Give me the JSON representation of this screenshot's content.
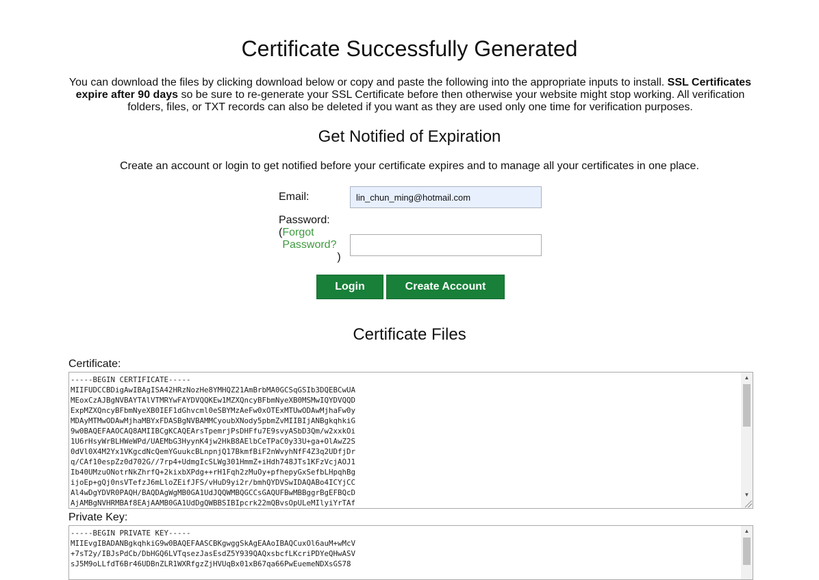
{
  "header": {
    "title": "Certificate Successfully Generated",
    "intro_before": "You can download the files by clicking download below or copy and paste the following into the appropriate inputs to install. ",
    "intro_bold": "SSL Certificates expire after 90 days",
    "intro_after": " so be sure to re-generate your SSL Certificate before then otherwise your website might stop working. All verification folders, files, or TXT records can also be deleted if you want as they are used only one time for verification purposes."
  },
  "notify": {
    "heading": "Get Notified of Expiration",
    "text": "Create an account or login to get notified before your certificate expires and to manage all your certificates in one place.",
    "email_label": "Email:",
    "email_value": "lin_chun_ming@hotmail.com",
    "password_label": "Password:",
    "forgot_open": "(",
    "forgot_link": "Forgot Password?",
    "forgot_close": ")",
    "password_value": "",
    "login_button": "Login",
    "create_button": "Create Account"
  },
  "files": {
    "heading": "Certificate Files",
    "certificate_label": "Certificate:",
    "certificate_text": "-----BEGIN CERTIFICATE-----\nMIIFUDCCBDigAwIBAgISA42HRzNozHe8YMHQZ21AmBrbMA0GCSqGSIb3DQEBCwUA\nMEoxCzAJBgNVBAYTAlVTMRYwFAYDVQQKEw1MZXQncyBFbmNyeXB0MSMwIQYDVQQD\nExpMZXQncyBFbmNyeXB0IEF1dGhvcml0eSBYMzAeFw0xOTExMTUwODAwMjhaFw0y\nMDAyMTMwODAwMjhaMBYxFDASBgNVBAMMCyoubXNody5pbmZvMIIBIjANBgkqhkiG\n9w0BAQEFAAOCAQ8AMIIBCgKCAQEArsTpemrjPsDHFfu7E9svyASbD3Qm/w2xxkOi\n1U6rHsyWrBLHWeWPd/UAEMbG3HyynK4jw2HkB8AElbCeTPaC0y33U+ga+OlAwZ2S\n0dVl0X4M2Yx1VKgcdNcQemYGuukcBLnpnjQ17BkmfBiF2nWvyhNfF4Z3q2UDfjDr\nq/CAf10espZz0d702G//7rp4+UdmgIcSLWg301HmmZ+iHdh748JTs1KFzVcjAOJ1\nIb40UMzuONotrNkZhrfQ+2kixbXPdg++rH1Fqh2zMuOy+pfhepyGxSefbLHpqhBg\nijoEp+gQj0nsVTefzJ6mLloZEifJFS/vHuD9yi2r/bmhQYDVSwIDAQABo4ICYjCC\nAl4wDgYDVR0PAQH/BAQDAgWgMB0GA1UdJQQWMBQGCCsGAQUFBwMBBggrBgEFBQcD\nAjAMBgNVHRMBAf8EAjAAMB0GA1UdDgQWBBSIBIpcrk22mQBvsOpULeMIlyiYrTAf",
    "private_key_label": "Private Key:",
    "private_key_text": "-----BEGIN PRIVATE KEY-----\nMIIEvgIBADANBgkqhkiG9w0BAQEFAASCBKgwggSkAgEAAoIBAQCuxOl6auM+wMcV\n+7sT2y/IBJsPdCb/DbHGQ6LVTqsezJasEsdZ5Y939QAQxsbcfLKcriPDYeQHwASV\nsJ5M9oLLfdT6Br46UDBnZLR1WXRfgzZjHVUqBx01xB67qa66PwEuemeNDXsGS78"
  },
  "icons": {
    "scroll_up": "▲",
    "scroll_down": "▼"
  }
}
